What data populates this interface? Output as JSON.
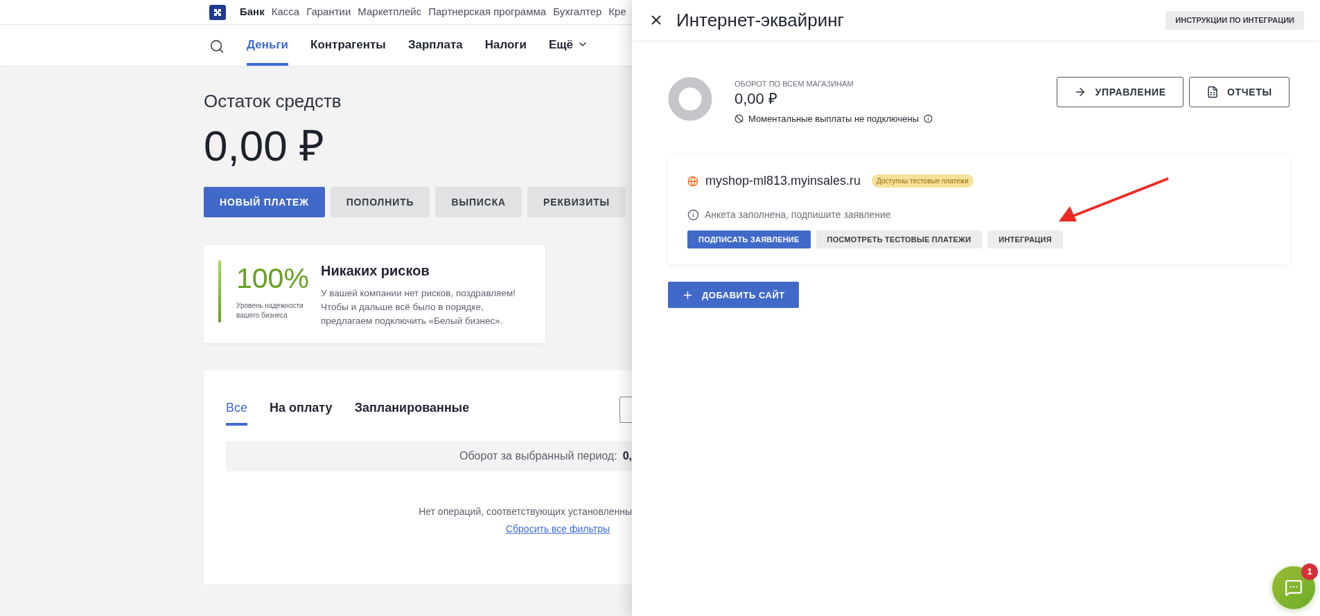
{
  "top_nav": {
    "items": [
      {
        "label": "Банк",
        "selected": true
      },
      {
        "label": "Касса",
        "selected": false
      },
      {
        "label": "Гарантии",
        "selected": false
      },
      {
        "label": "Маркетплейс",
        "selected": false
      },
      {
        "label": "Партнерская программа",
        "selected": false
      },
      {
        "label": "Бухгалтер",
        "selected": false
      },
      {
        "label": "Кре",
        "selected": false
      }
    ]
  },
  "main_nav": {
    "items": [
      {
        "label": "Деньги",
        "selected": true,
        "kind": "link"
      },
      {
        "label": "Контрагенты",
        "selected": false,
        "kind": "link"
      },
      {
        "label": "Зарплата",
        "selected": false,
        "kind": "link"
      },
      {
        "label": "Налоги",
        "selected": false,
        "kind": "link"
      },
      {
        "label": "Ещё",
        "selected": false,
        "kind": "dropdown"
      }
    ]
  },
  "balance": {
    "title": "Остаток средств",
    "amount": "0,00 ₽"
  },
  "actions": [
    {
      "label": "НОВЫЙ ПЛАТЕЖ",
      "kind": "primary"
    },
    {
      "label": "ПОПОЛНИТЬ",
      "kind": "secondary"
    },
    {
      "label": "ВЫПИСКА",
      "kind": "secondary"
    },
    {
      "label": "РЕКВИЗИТЫ",
      "kind": "secondary"
    }
  ],
  "risk_card": {
    "score": "100%",
    "caption": "Уровень надежности вашего бизнеса",
    "title": "Никаких рисков",
    "text": "У вашей компании нет рисков, поздравляем! Чтобы и дальше всё было в порядке, предлагаем подключить «Белый бизнес»."
  },
  "operations": {
    "tabs": [
      {
        "label": "Все",
        "selected": true
      },
      {
        "label": "На оплату",
        "selected": false
      },
      {
        "label": "Запланированные",
        "selected": false
      }
    ],
    "turnover": {
      "label": "Оборот за выбранный период:",
      "value": "0,"
    },
    "empty": {
      "message": "Нет операций, соответствующих установленны",
      "link": "Сбросить все фильтры"
    }
  },
  "drawer": {
    "title": "Интернет-эквайринг",
    "instructions_button": "ИНСТРУКЦИИ ПО ИНТЕГРАЦИИ",
    "summary": {
      "label": "ОБОРОТ ПО ВСЕМ МАГАЗИНАМ",
      "amount": "0,00 ₽",
      "notice": "Моментальные выплаты не подключены"
    },
    "actions": [
      {
        "label": "УПРАВЛЕНИЕ",
        "kind": "arrow"
      },
      {
        "label": "ОТЧЕТЫ",
        "kind": "spreadsheet"
      }
    ],
    "sites": [
      {
        "domain": "myshop-ml813.myinsales.ru",
        "badge": "Доступны тестовые платежи",
        "status": "Анкета заполнена, подпишите заявление",
        "buttons": [
          {
            "label": "ПОДПИСАТЬ ЗАЯВЛЕНИЕ",
            "kind": "primary"
          },
          {
            "label": "ПОСМОТРЕТЬ ТЕСТОВЫЕ ПЛАТЕЖИ",
            "kind": "secondary"
          },
          {
            "label": "ИНТЕГРАЦИЯ",
            "kind": "secondary"
          }
        ]
      }
    ],
    "add_button": "ДОБАВИТЬ САЙТ"
  },
  "chat": {
    "badge": "1"
  }
}
